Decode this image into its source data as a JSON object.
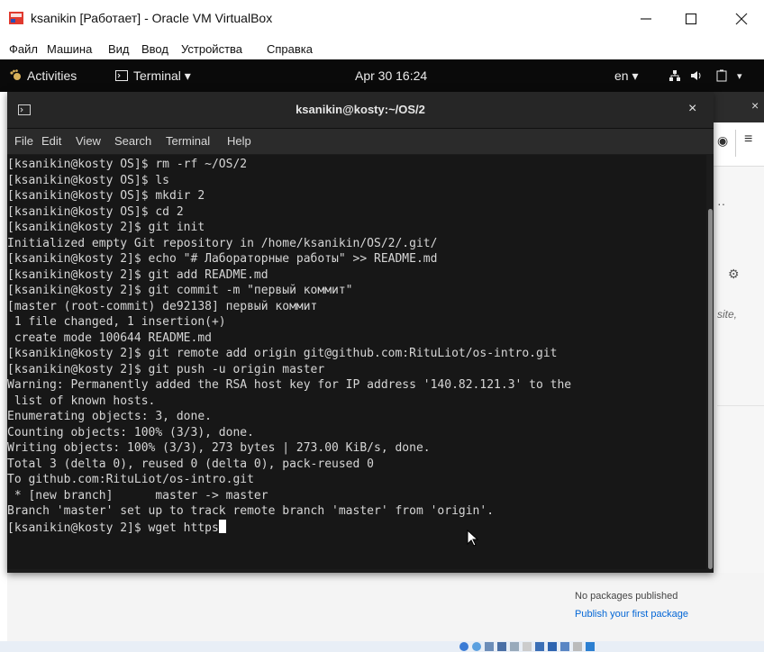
{
  "vbox": {
    "title": "ksanikin [Работает] - Oracle VM VirtualBox",
    "menu": [
      "Файл",
      "Машина",
      "Вид",
      "Ввод",
      "Устройства",
      "Справка"
    ]
  },
  "gnome_panel": {
    "activities": "Activities",
    "terminal_menu": "Terminal ▾",
    "clock": "Apr 30 16:24",
    "keyboard_layout": "en ▾"
  },
  "terminal": {
    "title": "ksanikin@kosty:~/OS/2",
    "menu": [
      "File",
      "Edit",
      "View",
      "Search",
      "Terminal",
      "Help"
    ],
    "lines": [
      "[ksanikin@kosty OS]$ rm -rf ~/OS/2",
      "[ksanikin@kosty OS]$ ls",
      "[ksanikin@kosty OS]$ mkdir 2",
      "[ksanikin@kosty OS]$ cd 2",
      "[ksanikin@kosty 2]$ git init",
      "Initialized empty Git repository in /home/ksanikin/OS/2/.git/",
      "[ksanikin@kosty 2]$ echo \"# Лабораторные работы\" >> README.md",
      "[ksanikin@kosty 2]$ git add README.md",
      "[ksanikin@kosty 2]$ git commit -m \"первый коммит\"",
      "[master (root-commit) de92138] первый коммит",
      " 1 file changed, 1 insertion(+)",
      " create mode 100644 README.md",
      "[ksanikin@kosty 2]$ git remote add origin git@github.com:RituLiot/os-intro.git",
      "[ksanikin@kosty 2]$ git push -u origin master",
      "Warning: Permanently added the RSA host key for IP address '140.82.121.3' to the",
      " list of known hosts.",
      "Enumerating objects: 3, done.",
      "Counting objects: 100% (3/3), done.",
      "Writing objects: 100% (3/3), 273 bytes | 273.00 KiB/s, done.",
      "Total 3 (delta 0), reused 0 (delta 0), pack-reused 0",
      "To github.com:RituLiot/os-intro.git",
      " * [new branch]      master -> master",
      "Branch 'master' set up to track remote branch 'master' from 'origin'."
    ],
    "prompt_line": "[ksanikin@kosty 2]$ wget https"
  },
  "background_window": {
    "partial_text": "site,",
    "no_packages": "No packages published",
    "publish_link": "Publish your first package"
  },
  "colors": {
    "terminal_bg": "#171717",
    "panel_bg": "#0a0a0a",
    "link": "#0366d6"
  }
}
